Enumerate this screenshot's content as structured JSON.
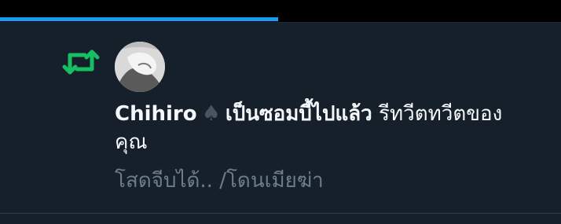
{
  "progress": {
    "value": 0.496,
    "color": "#1d9bf0"
  },
  "notification": {
    "icon": "retweet-icon",
    "icon_color": "#17bf63",
    "avatar": "avatar",
    "user_name": "Chihiro",
    "badge_icon": "spade-icon",
    "badge_glyph": "♠",
    "user_suffix": "เป็นซอมบี้ไปแล้ว",
    "action_text": "รีทวีตทวีตของคุณ",
    "tweet_preview": "โสดจีบได้.. /โดนเมียฆ่า"
  },
  "colors": {
    "background": "#15202b",
    "text": "#f5f8fa",
    "muted": "#6e7d8a"
  }
}
